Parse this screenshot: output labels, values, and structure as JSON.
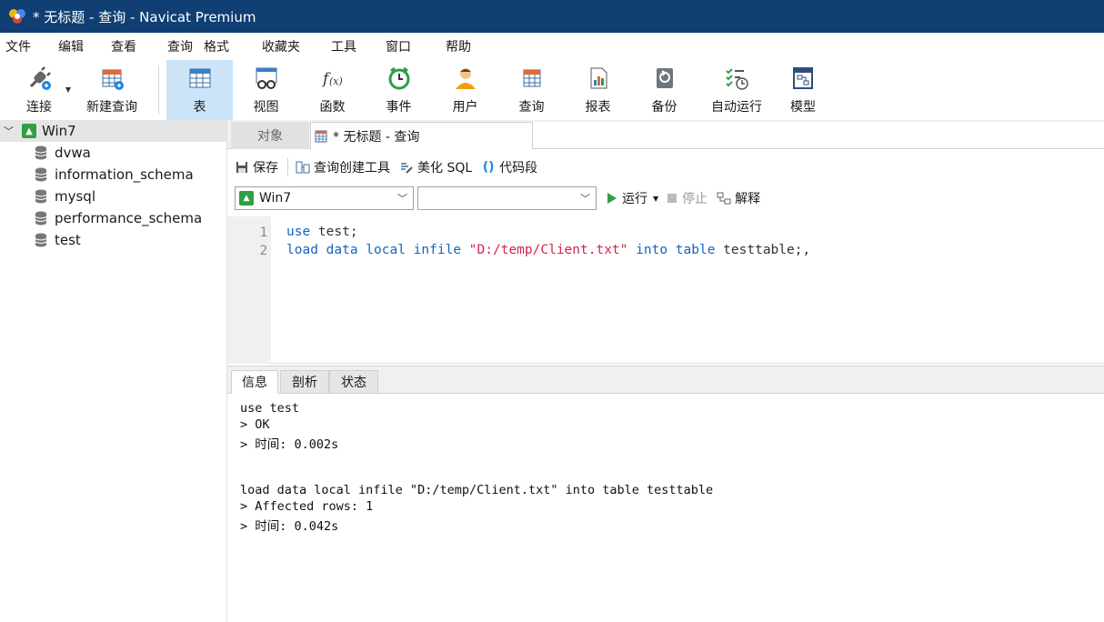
{
  "window": {
    "title": "* 无标题 - 查询 - Navicat Premium"
  },
  "menu": [
    "文件",
    "编辑",
    "查看",
    "查询",
    "格式",
    "收藏夹",
    "工具",
    "窗口",
    "帮助"
  ],
  "toolbar": {
    "items": [
      {
        "label": "连接",
        "icon": "plug-icon"
      },
      {
        "label": "新建查询",
        "icon": "new-query-icon"
      },
      {
        "label": "表",
        "icon": "table-icon",
        "active": true
      },
      {
        "label": "视图",
        "icon": "view-icon"
      },
      {
        "label": "函数",
        "icon": "function-icon"
      },
      {
        "label": "事件",
        "icon": "event-clock-icon"
      },
      {
        "label": "用户",
        "icon": "user-icon"
      },
      {
        "label": "查询",
        "icon": "query-icon"
      },
      {
        "label": "报表",
        "icon": "report-icon"
      },
      {
        "label": "备份",
        "icon": "backup-icon"
      },
      {
        "label": "自动运行",
        "icon": "autorun-icon"
      },
      {
        "label": "模型",
        "icon": "model-icon"
      }
    ]
  },
  "sidebar": {
    "connection": "Win7",
    "databases": [
      "dvwa",
      "information_schema",
      "mysql",
      "performance_schema",
      "test"
    ]
  },
  "tabs": {
    "objects": "对象",
    "query": "* 无标题 - 查询"
  },
  "query_toolbar": {
    "save": "保存",
    "builder": "查询创建工具",
    "beautify": "美化 SQL",
    "snippet": "代码段"
  },
  "selectors": {
    "connection": "Win7",
    "database": "",
    "run": "运行",
    "stop": "停止",
    "explain": "解释"
  },
  "editor": {
    "line_numbers": [
      "1",
      "2"
    ],
    "line1": {
      "kw": "use",
      "rest": " test;"
    },
    "line2": {
      "kw": "load data local infile",
      "str": "\"D:/temp/Client.txt\"",
      "kw2": "into table",
      "rest": " testtable;,"
    }
  },
  "result_tabs": [
    "信息",
    "剖析",
    "状态"
  ],
  "messages": [
    "use test",
    "> OK",
    "> 时间: 0.002s",
    "",
    "",
    "load data local infile \"D:/temp/Client.txt\" into table testtable",
    "> Affected rows: 1",
    "> 时间: 0.042s"
  ],
  "colors": {
    "titlebar": "#0f3f73",
    "active_toolbar": "#cce4f7",
    "keyword": "#1565c0",
    "string": "#d0264a"
  }
}
